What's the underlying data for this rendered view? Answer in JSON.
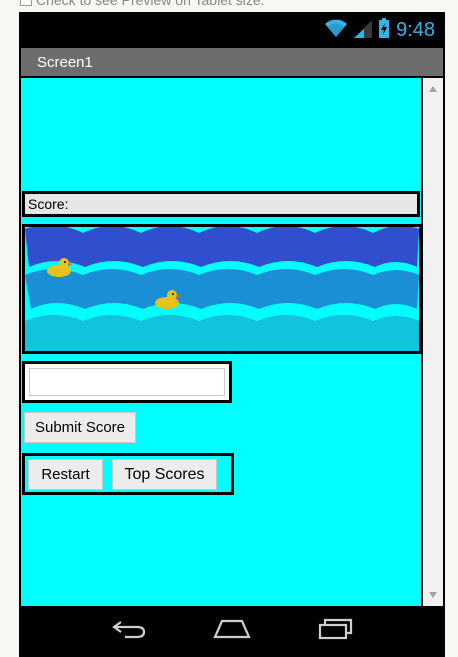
{
  "preview_option": {
    "label": "Check to see Preview on Tablet size."
  },
  "status_bar": {
    "time": "9:48",
    "icons": [
      "wifi-icon",
      "signal-icon",
      "battery-icon"
    ]
  },
  "app": {
    "screen_title": "Screen1",
    "background_color": "#00ffff"
  },
  "score_label": {
    "text": "Score:"
  },
  "game_canvas": {
    "sprites": [
      "duck-sprite",
      "duck-sprite"
    ],
    "wave_colors": [
      "#2f4fcf",
      "#1a8fd6",
      "#11c3dc"
    ]
  },
  "name_input": {
    "value": "",
    "placeholder": ""
  },
  "buttons": {
    "submit": "Submit Score",
    "restart": "Restart",
    "top_scores": "Top Scores"
  },
  "nav_bar": {
    "icons": [
      "back-icon",
      "home-icon",
      "recent-apps-icon"
    ]
  }
}
